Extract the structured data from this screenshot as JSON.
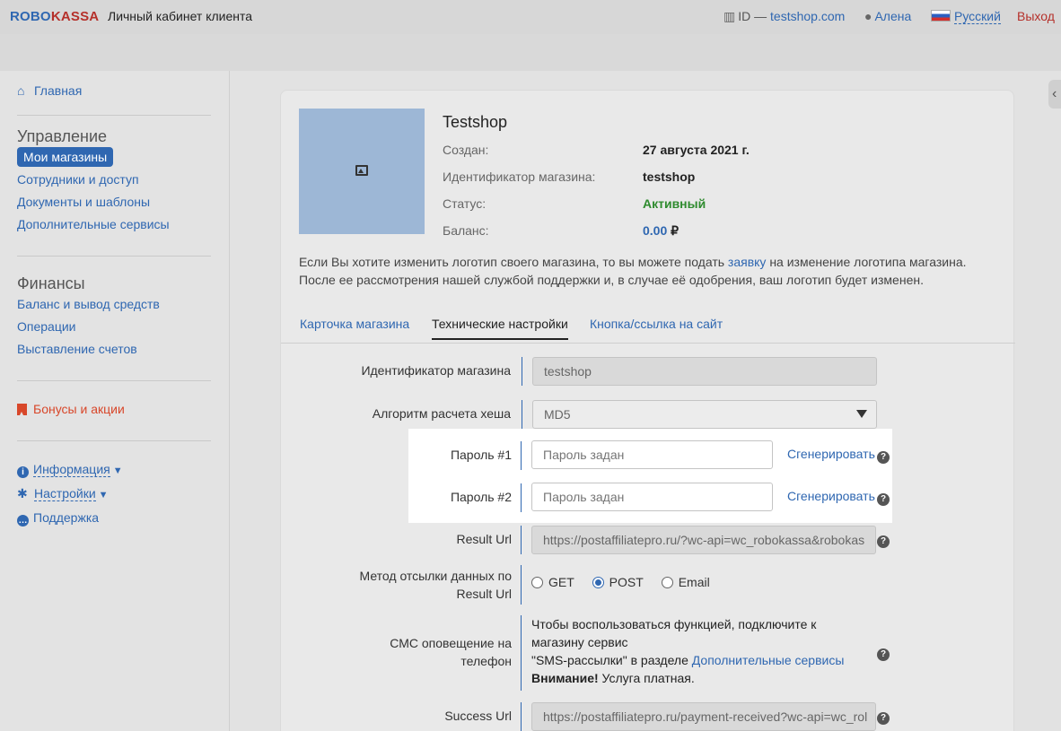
{
  "header": {
    "logo_part1": "ROBO",
    "logo_part2": "KASSA",
    "title": "Личный кабинет клиента",
    "id_label": "ID —",
    "id_value": "testshop.com",
    "user": "Алена",
    "language": "Русский",
    "exit": "Выход"
  },
  "sidebar": {
    "home": "Главная",
    "management_heading": "Управление",
    "my_shops": "Мои магазины",
    "staff": "Сотрудники и доступ",
    "documents": "Документы и шаблоны",
    "services": "Дополнительные сервисы",
    "finance_heading": "Финансы",
    "balance": "Баланс и вывод средств",
    "operations": "Операции",
    "invoices": "Выставление счетов",
    "bonuses": "Бонусы и акции",
    "info": "Информация",
    "settings": "Настройки",
    "support": "Поддержка"
  },
  "shop": {
    "name": "Testshop",
    "created_label": "Создан:",
    "created_value": "27 августа 2021 г.",
    "id_label": "Идентификатор магазина:",
    "id_value": "testshop",
    "status_label": "Статус:",
    "status_value": "Активный",
    "balance_label": "Баланс:",
    "balance_value": "0.00",
    "currency": "₽"
  },
  "note": {
    "line1_before": "Если Вы хотите изменить логотип своего магазина, то вы можете подать ",
    "line1_link": "заявку",
    "line1_after": " на изменение логотипа магазина.",
    "line2": "После ее рассмотрения нашей службой поддержки и, в случае её одобрения, ваш логотип будет изменен."
  },
  "tabs": {
    "card": "Карточка магазина",
    "tech": "Технические настройки",
    "button": "Кнопка/ссылка на сайт"
  },
  "form": {
    "shop_id_label": "Идентификатор магазина",
    "shop_id_value": "testshop",
    "hash_label": "Алгоритм расчета хеша",
    "hash_value": "MD5",
    "pass1_label": "Пароль #1",
    "pass1_placeholder": "Пароль задан",
    "pass2_label": "Пароль #2",
    "pass2_placeholder": "Пароль задан",
    "generate": "Сгенерировать",
    "result_url_label": "Result Url",
    "result_url_value": "https://postaffiliatepro.ru/?wc-api=wc_robokassa&robokas",
    "method_label_1": "Метод отсылки данных по",
    "method_label_2": "Result Url",
    "method_get": "GET",
    "method_post": "POST",
    "method_email": "Email",
    "sms_label_1": "СМС оповещение на",
    "sms_label_2": "телефон",
    "sms_line1": "Чтобы воспользоваться функцией, подключите к",
    "sms_line2": "магазину сервис",
    "sms_line3_before": "\"SMS-рассылки\" в разделе ",
    "sms_line3_link": "Дополнительные сервисы",
    "sms_warn_bold": "Внимание!",
    "sms_warn_rest": " Услуга платная.",
    "success_url_label": "Success Url",
    "success_url_value": "https://postaffiliatepro.ru/payment-received?wc-api=wc_rol"
  },
  "help_glyph": "?",
  "icons": {
    "building": "building-icon",
    "user": "user-icon",
    "flag": "russia-flag-icon",
    "home": "home-icon",
    "image": "image-placeholder-icon",
    "gear": "gear-icon",
    "info": "info-icon",
    "support": "chat-icon",
    "bonus": "bookmark-icon"
  },
  "colors": {
    "brand_blue": "#2f67b1",
    "brand_red": "#b5302a",
    "active_green": "#2e8b2e",
    "bonus_orange": "#d8472a"
  }
}
